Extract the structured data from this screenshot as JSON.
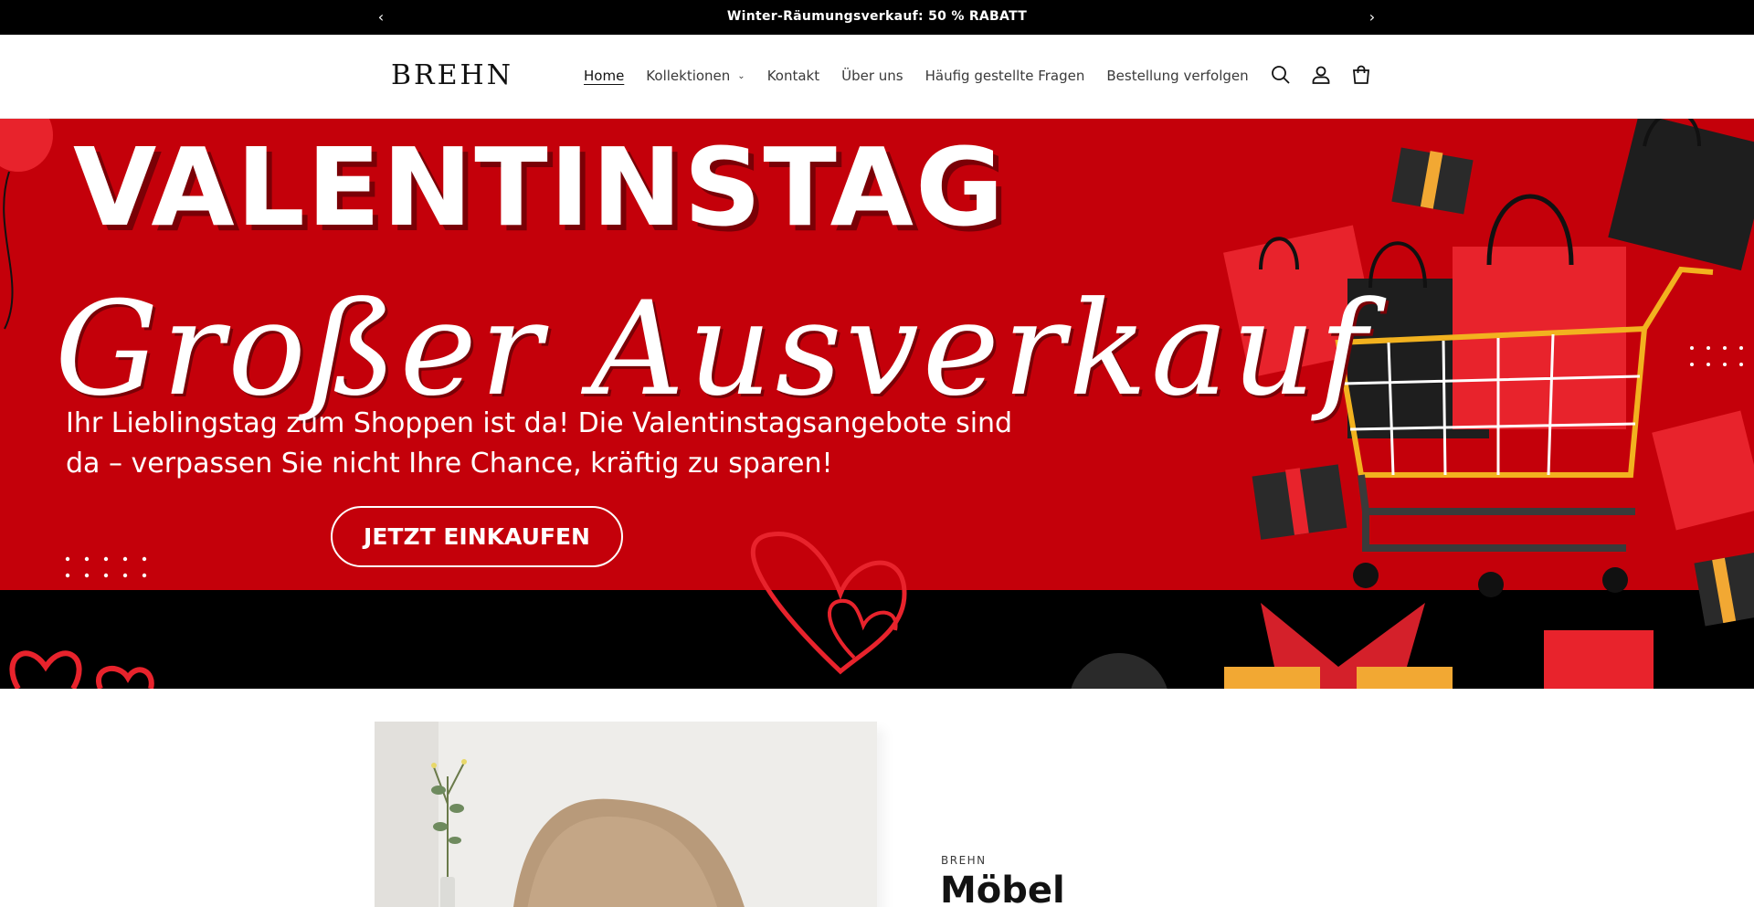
{
  "announcement": {
    "text": "Winter-Räumungsverkauf: 50 % RABATT",
    "prev_icon": "chevron-left-icon",
    "next_icon": "chevron-right-icon"
  },
  "header": {
    "logo": "BREHN",
    "nav": [
      {
        "label": "Home",
        "active": true
      },
      {
        "label": "Kollektionen",
        "has_dropdown": true
      },
      {
        "label": "Kontakt"
      },
      {
        "label": "Über uns"
      },
      {
        "label": "Häufig gestellte Fragen"
      },
      {
        "label": "Bestellung verfolgen"
      }
    ],
    "icons": [
      "search-icon",
      "account-icon",
      "cart-icon"
    ]
  },
  "hero": {
    "headline": "VALENTINSTAG",
    "script_title": "Großer Ausverkauf",
    "subtitle": "Ihr Lieblingstag zum Shoppen ist da! Die Valentinstagsangebote sind da – verpassen Sie nicht Ihre Chance, kräftig zu sparen!",
    "cta": "JETZT EINKAUFEN",
    "colors": {
      "background": "#c4000a",
      "band": "#000000",
      "cart": "#f2b21f"
    }
  },
  "featured": {
    "vendor": "BREHN",
    "title": "Möbel"
  }
}
